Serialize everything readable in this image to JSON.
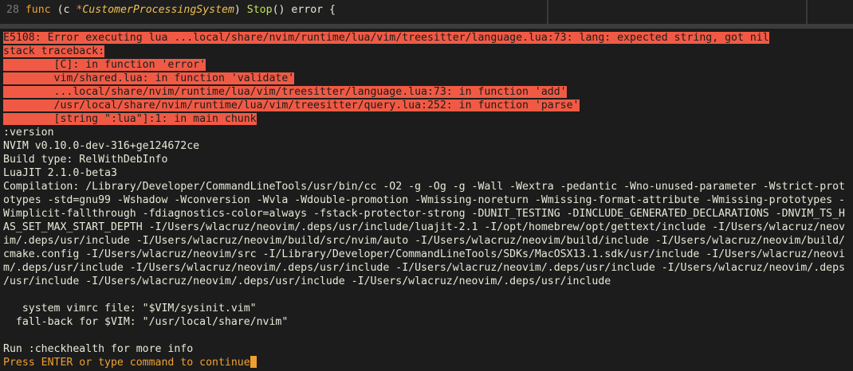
{
  "editor": {
    "line_number": "28",
    "code": {
      "kw_func": "func",
      "open": "(c ",
      "ptr": "*",
      "type": "CustomerProcessingSystem",
      "close": ") ",
      "fn": "Stop",
      "rest": "() error {"
    }
  },
  "error": {
    "lines": [
      "E5108: Error executing lua ...local/share/nvim/runtime/lua/vim/treesitter/language.lua:73: lang: expected string, got nil",
      "stack traceback:",
      "        [C]: in function 'error'",
      "        vim/shared.lua: in function 'validate'",
      "        ...local/share/nvim/runtime/lua/vim/treesitter/language.lua:73: in function 'add'",
      "        /usr/local/share/nvim/runtime/lua/vim/treesitter/query.lua:252: in function 'parse'",
      "        [string \":lua\"]:1: in main chunk"
    ]
  },
  "version": {
    "lines": [
      ":version",
      "NVIM v0.10.0-dev-316+ge124672ce",
      "Build type: RelWithDebInfo",
      "LuaJIT 2.1.0-beta3",
      "Compilation: /Library/Developer/CommandLineTools/usr/bin/cc -O2 -g -Og -g -Wall -Wextra -pedantic -Wno-unused-parameter -Wstrict-prot",
      "otypes -std=gnu99 -Wshadow -Wconversion -Wvla -Wdouble-promotion -Wmissing-noreturn -Wmissing-format-attribute -Wmissing-prototypes -",
      "Wimplicit-fallthrough -fdiagnostics-color=always -fstack-protector-strong -DUNIT_TESTING -DINCLUDE_GENERATED_DECLARATIONS -DNVIM_TS_H",
      "AS_SET_MAX_START_DEPTH -I/Users/wlacruz/neovim/.deps/usr/include/luajit-2.1 -I/opt/homebrew/opt/gettext/include -I/Users/wlacruz/neov",
      "im/.deps/usr/include -I/Users/wlacruz/neovim/build/src/nvim/auto -I/Users/wlacruz/neovim/build/include -I/Users/wlacruz/neovim/build/",
      "cmake.config -I/Users/wlacruz/neovim/src -I/Library/Developer/CommandLineTools/SDKs/MacOSX13.1.sdk/usr/include -I/Users/wlacruz/neovi",
      "m/.deps/usr/include -I/Users/wlacruz/neovim/.deps/usr/include -I/Users/wlacruz/neovim/.deps/usr/include -I/Users/wlacruz/neovim/.deps",
      "/usr/include -I/Users/wlacruz/neovim/.deps/usr/include -I/Users/wlacruz/neovim/.deps/usr/include",
      "",
      "   system vimrc file: \"$VIM/sysinit.vim\"",
      "  fall-back for $VIM: \"/usr/local/share/nvim\"",
      "",
      "Run :checkhealth for more info"
    ]
  },
  "prompt": {
    "text": "Press ENTER or type command to continue"
  },
  "colors": {
    "error_bg": "#f05a45",
    "prompt_fg": "#f0a030",
    "background": "#1c1c1c"
  }
}
